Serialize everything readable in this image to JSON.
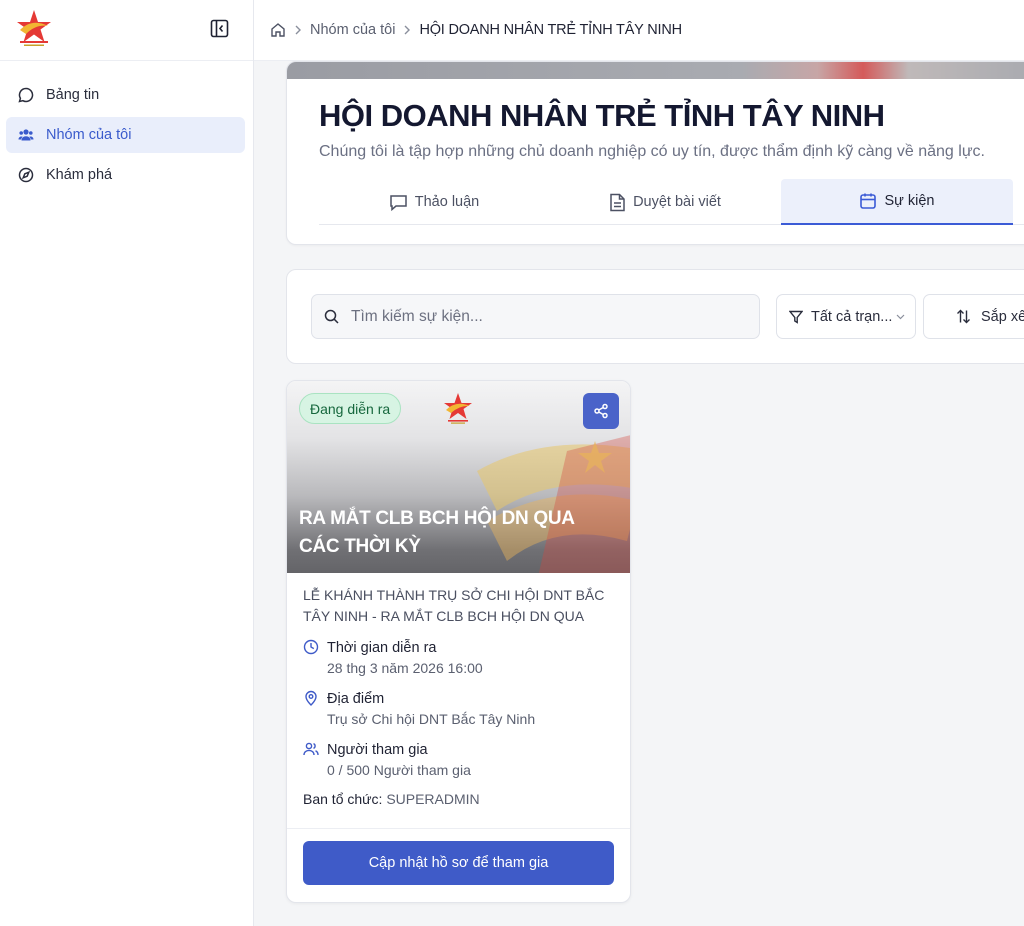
{
  "sidebar": {
    "logo_icon": "hoi-doanh-nhan-tre-logo",
    "collapse_icon": "sidebar-collapse-icon",
    "items": [
      {
        "label": "Bảng tin",
        "icon": "chat-bubble-icon",
        "active": false
      },
      {
        "label": "Nhóm của tôi",
        "icon": "users-icon",
        "active": true
      },
      {
        "label": "Khám phá",
        "icon": "compass-icon",
        "active": false
      }
    ]
  },
  "breadcrumb": {
    "home_icon": "home-icon",
    "items": [
      "Nhóm của tôi",
      "HỘI DOANH NHÂN TRẺ TỈNH TÂY NINH"
    ]
  },
  "group": {
    "title": "HỘI DOANH NHÂN TRẺ TỈNH TÂY NINH",
    "description": "Chúng tôi là tập hợp những chủ doanh nghiệp có uy tín, được thẩm định kỹ càng về năng lực.",
    "tabs": [
      {
        "label": "Thảo luận",
        "icon": "message-square-icon",
        "active": false
      },
      {
        "label": "Duyệt bài viết",
        "icon": "file-text-icon",
        "active": false
      },
      {
        "label": "Sự kiện",
        "icon": "calendar-icon",
        "active": true
      }
    ]
  },
  "filters": {
    "search_placeholder": "Tìm kiếm sự kiện...",
    "search_value": "",
    "status_label": "Tất cả trạn...",
    "sort_label": "Sắp xếp"
  },
  "event": {
    "status": "Đang diễn ra",
    "title": "RA MẮT CLB BCH HỘI DN QUA CÁC THỜI KỲ",
    "description": "LỄ KHÁNH THÀNH TRỤ SỞ CHI HỘI DNT BẮC TÂY NINH - RA MẮT CLB BCH HỘI DN QUA CÁC THỜI KỲ",
    "time_label": "Thời gian diễn ra",
    "time_value": "28 thg 3 năm 2026 16:00",
    "location_label": "Địa điểm",
    "location_value": "Trụ sở Chi hội DNT Bắc Tây Ninh",
    "participants_label": "Người tham gia",
    "participants_value": "0 / 500 Người tham gia",
    "organizer_label": "Ban tổ chức:",
    "organizer_value": "SUPERADMIN",
    "join_button": "Cập nhật hồ sơ để tham gia"
  },
  "colors": {
    "primary": "#3f5bc8",
    "active_nav_bg": "#e9eefb",
    "badge_bg": "#d7f4e3",
    "badge_text": "#16673d"
  }
}
